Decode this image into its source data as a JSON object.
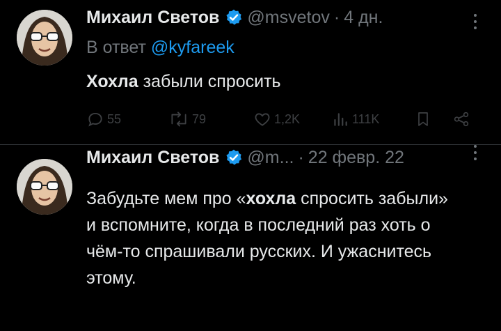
{
  "tweet1": {
    "author": "Михаил Светов",
    "handle": "@msvetov",
    "dot": "·",
    "time": "4 дн.",
    "reply_prefix": "В ответ",
    "reply_to": "@kyfareek",
    "text_bold": "Хохла",
    "text_rest": " забыли спросить",
    "stats": {
      "replies": "55",
      "retweets": "79",
      "likes": "1,2K",
      "views": "111K"
    }
  },
  "tweet2": {
    "author": "Михаил Светов",
    "handle": "@m...",
    "dot": "·",
    "time": "22 февр. 22",
    "text_part1": "Забудьте мем про «",
    "text_bold": "хохла",
    "text_part2": " спросить забыли» и вспомните, когда в последний раз хоть о чём-то спрашивали русских. И ужаснитесь этому."
  },
  "colors": {
    "background": "#000000",
    "text": "#e7e9ea",
    "secondary": "#71767b",
    "accent": "#1d9bf0",
    "divider": "#2f3336"
  },
  "icons": [
    "verified-badge-icon",
    "more-icon",
    "reply-icon",
    "retweet-icon",
    "like-icon",
    "views-icon",
    "bookmark-icon",
    "share-icon"
  ]
}
